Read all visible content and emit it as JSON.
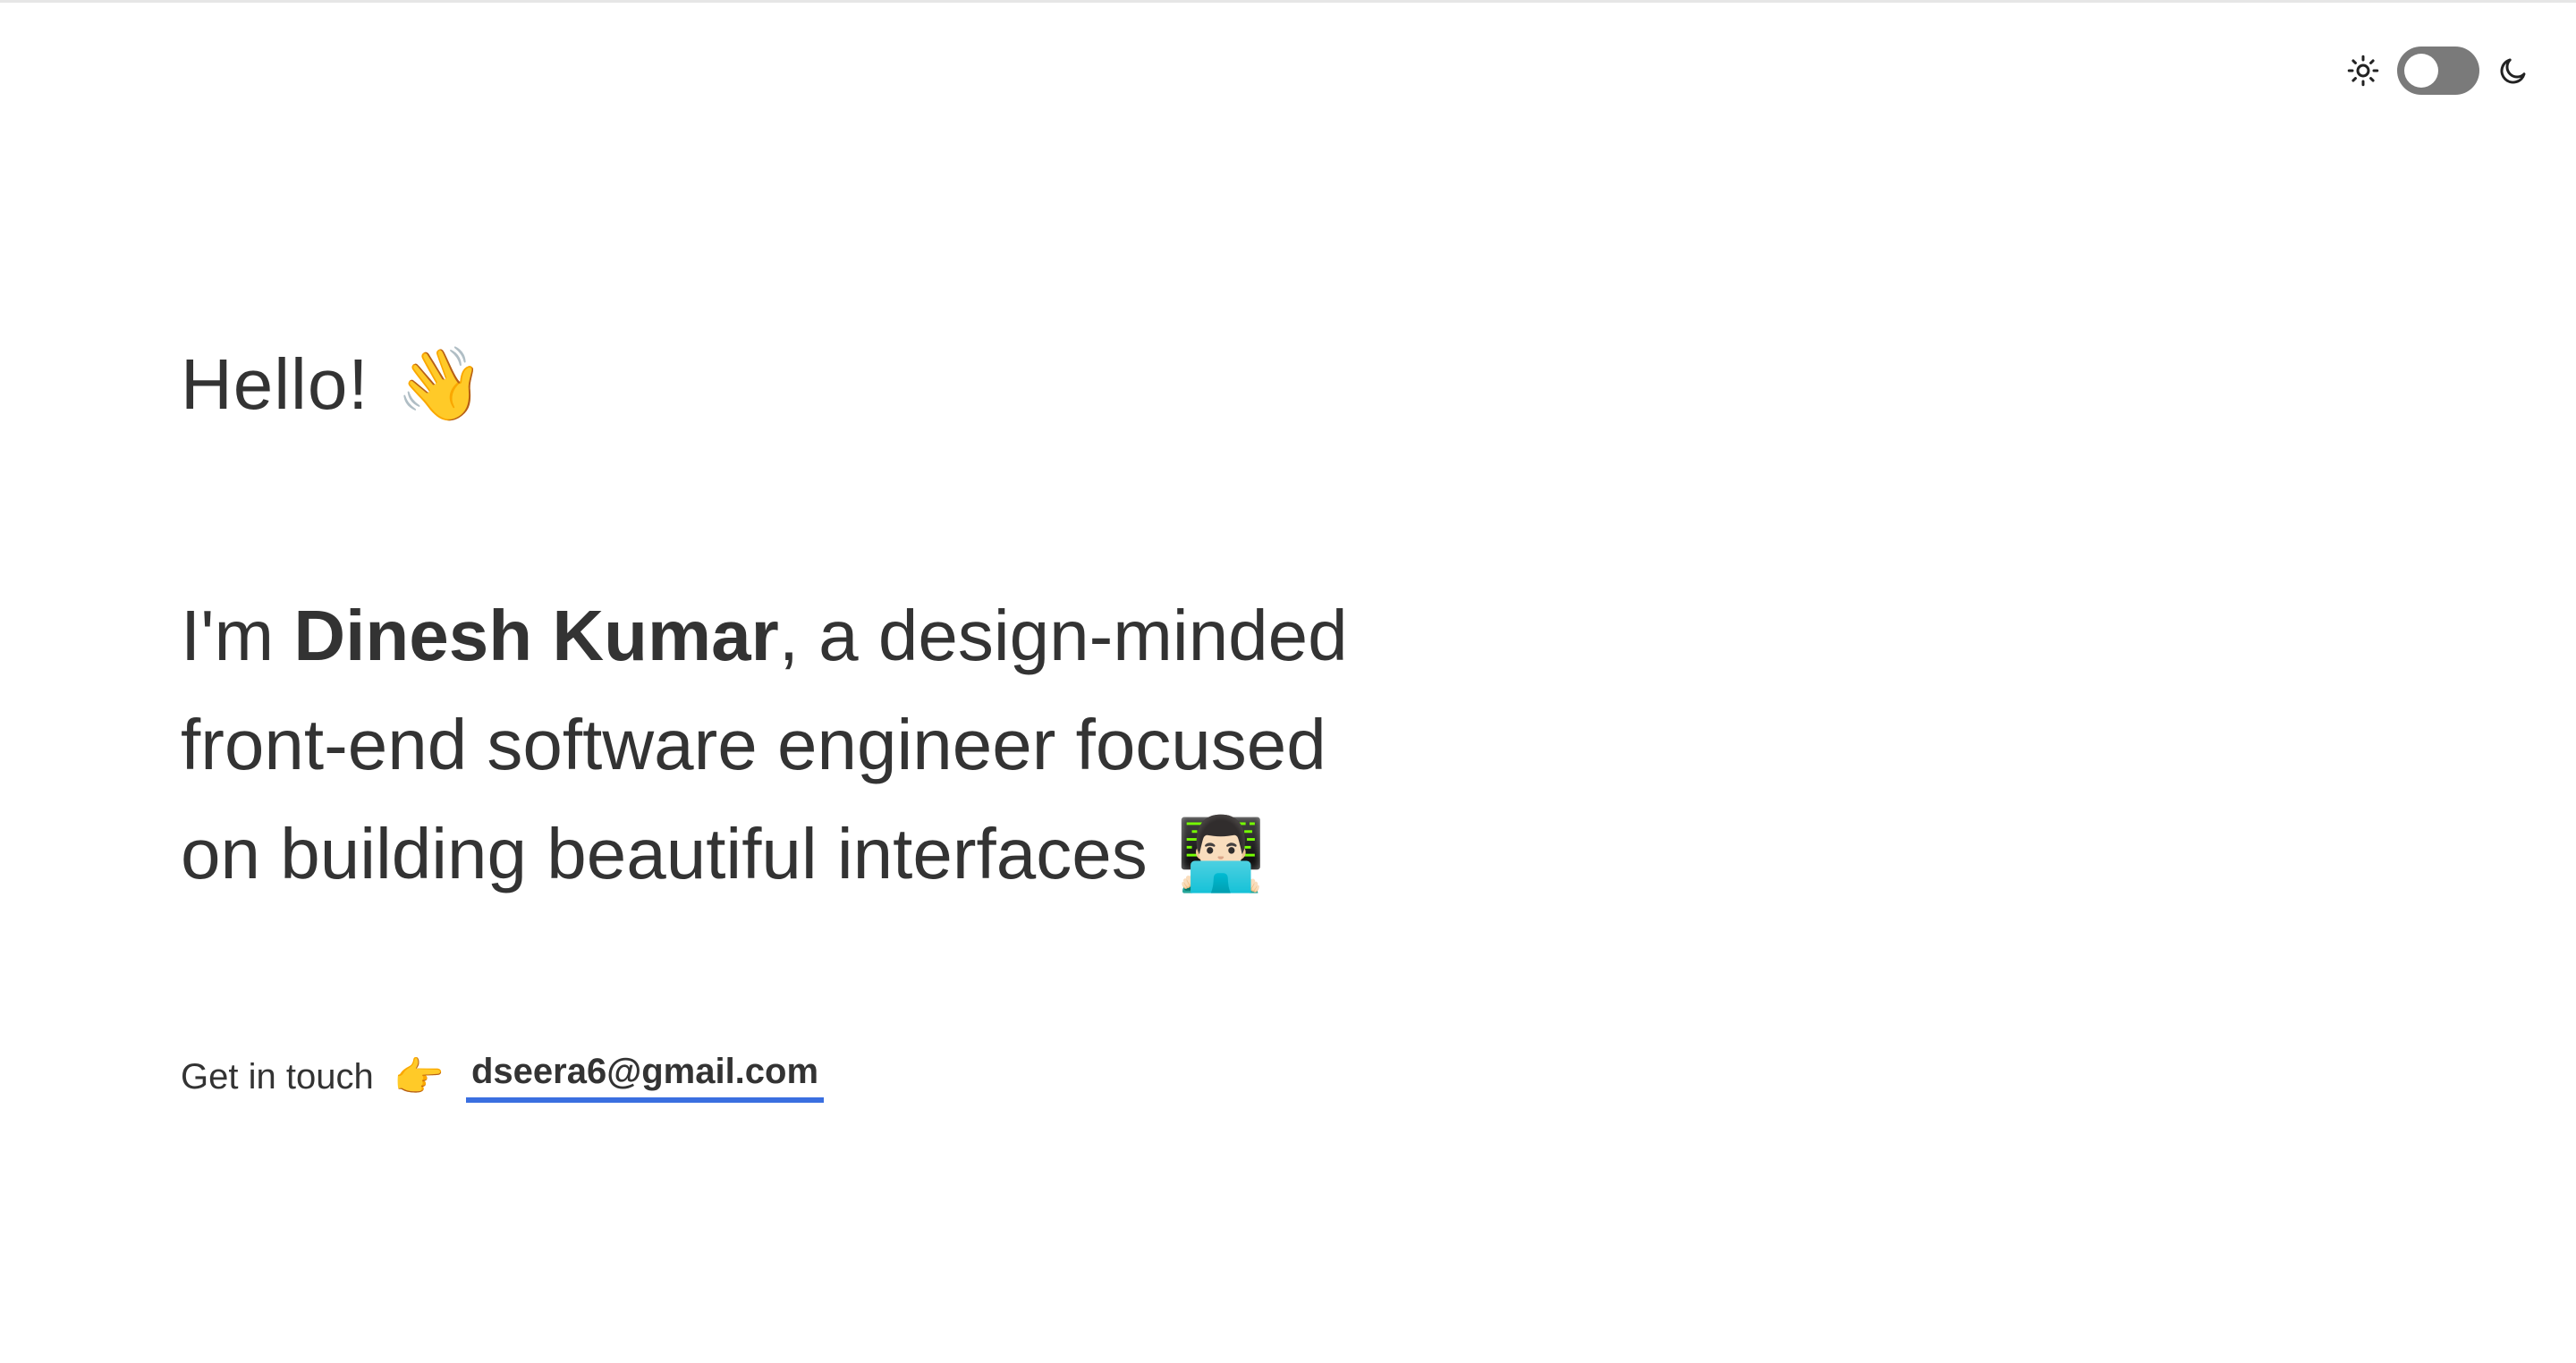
{
  "theme_toggle": {
    "light_icon": "sun-icon",
    "dark_icon": "moon-icon",
    "state": "light"
  },
  "hero": {
    "greeting": "Hello!",
    "greeting_emoji": "👋",
    "intro_prefix": "I'm ",
    "name": "Dinesh Kumar",
    "intro_line1_rest": ", a design-minded",
    "intro_line2": "front-end software engineer focused",
    "intro_line3": "on building beautiful interfaces",
    "intro_emoji": "👨🏻‍💻"
  },
  "contact": {
    "label": "Get in touch",
    "pointer_emoji": "👉",
    "email": "dseera6@gmail.com"
  },
  "colors": {
    "text": "#333333",
    "link_underline": "#3a6fe0",
    "toggle_track": "#7a7a7a",
    "background": "#ffffff"
  }
}
